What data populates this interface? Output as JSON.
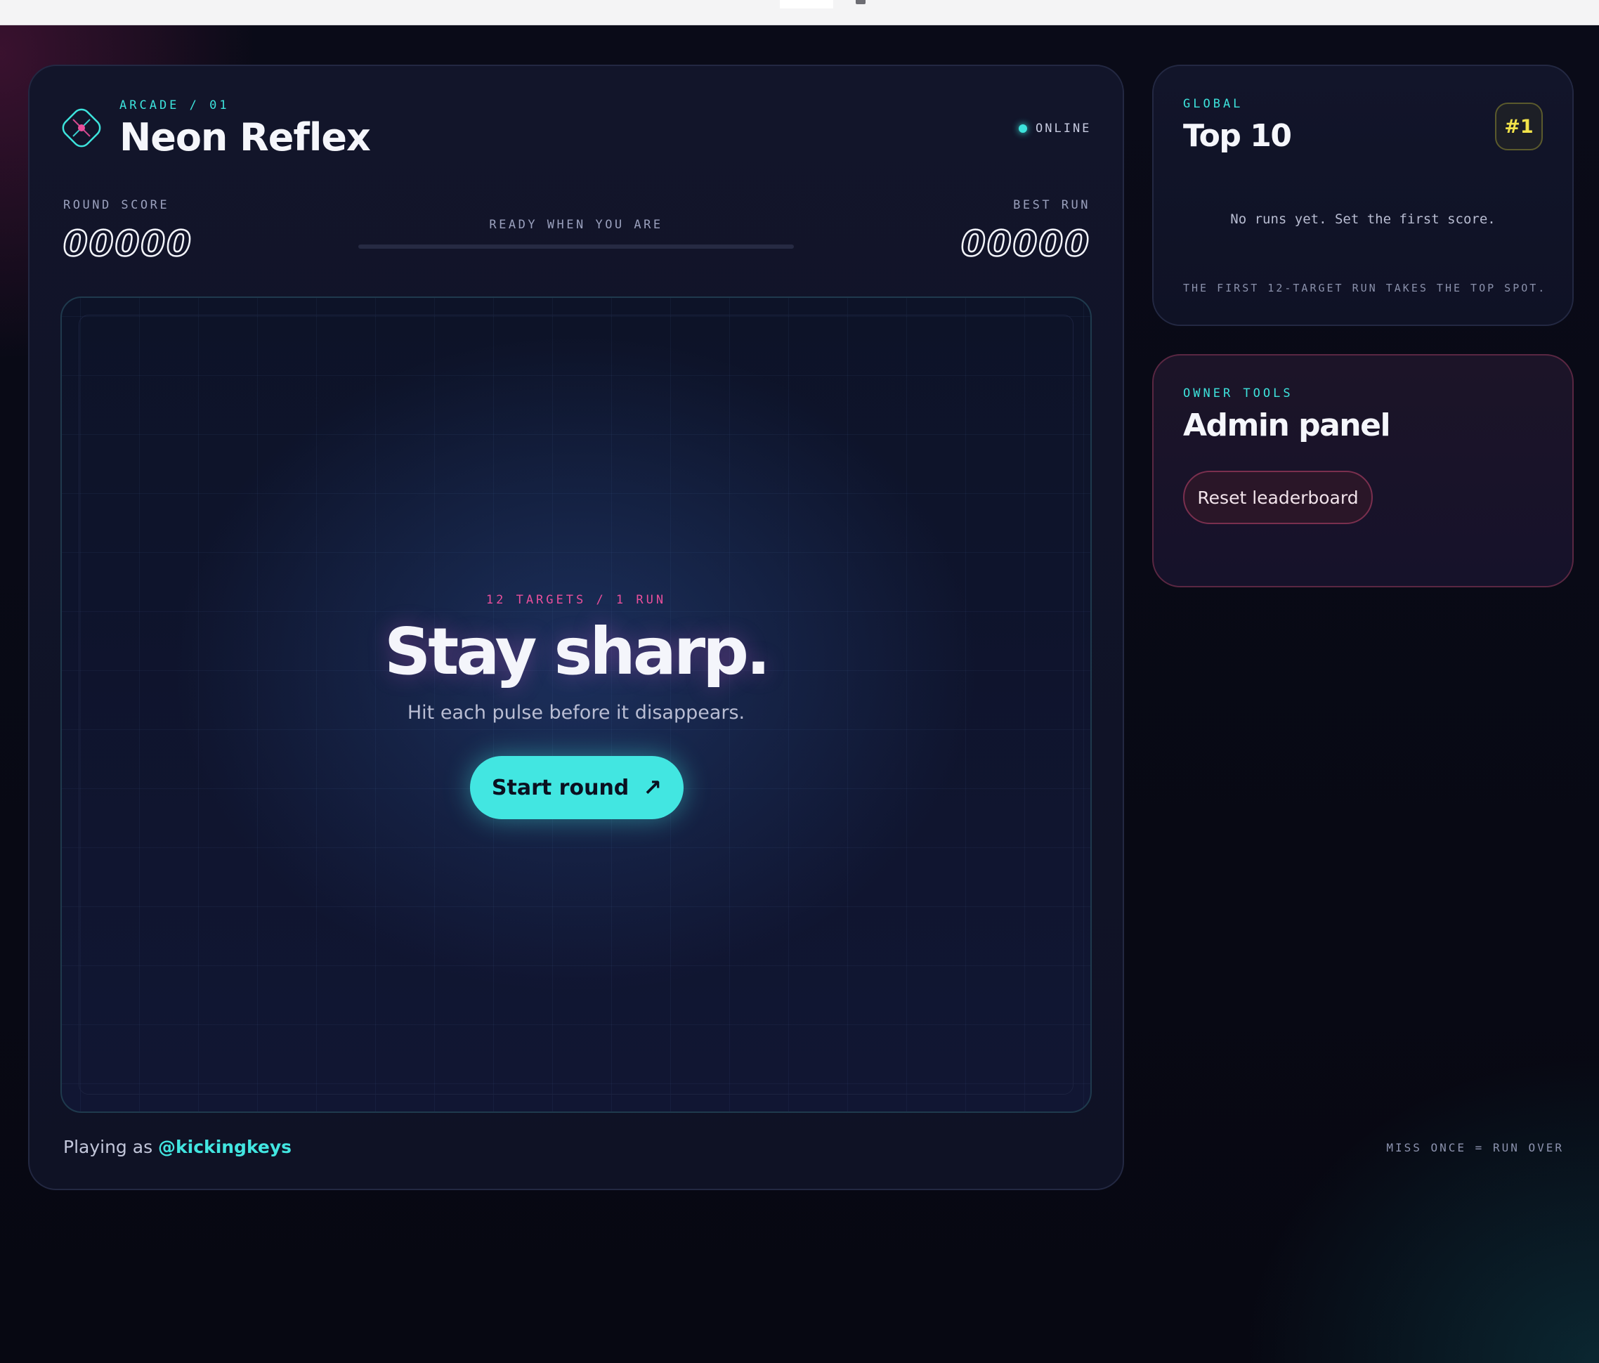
{
  "header": {
    "eyebrow": "ARCADE / 01",
    "title": "Neon Reflex",
    "status": "ONLINE"
  },
  "stats": {
    "round_label": "ROUND SCORE",
    "round_value": "00000",
    "status_label": "READY WHEN YOU ARE",
    "progress": 0,
    "best_label": "BEST RUN",
    "best_value": "00000"
  },
  "arena": {
    "eyebrow": "12 TARGETS / 1 RUN",
    "title": "Stay sharp.",
    "subtitle": "Hit each pulse before it disappears.",
    "start_label": "Start round",
    "start_icon": "arrow-up-right-icon"
  },
  "footer": {
    "playing_as": "Playing as",
    "handle": "@kickingkeys",
    "rule": "MISS ONCE = RUN OVER"
  },
  "leaderboard": {
    "eyebrow": "GLOBAL",
    "title": "Top 10",
    "badge": "#1",
    "empty": "No runs yet. Set the first score.",
    "hint": "THE FIRST 12-TARGET RUN TAKES THE TOP SPOT."
  },
  "admin": {
    "eyebrow": "OWNER TOOLS",
    "title": "Admin panel",
    "reset_label": "Reset leaderboard"
  },
  "colors": {
    "accent": "#42e6e1",
    "pink": "#e94f9b",
    "gold": "#f2e34a",
    "background": "#080914"
  }
}
